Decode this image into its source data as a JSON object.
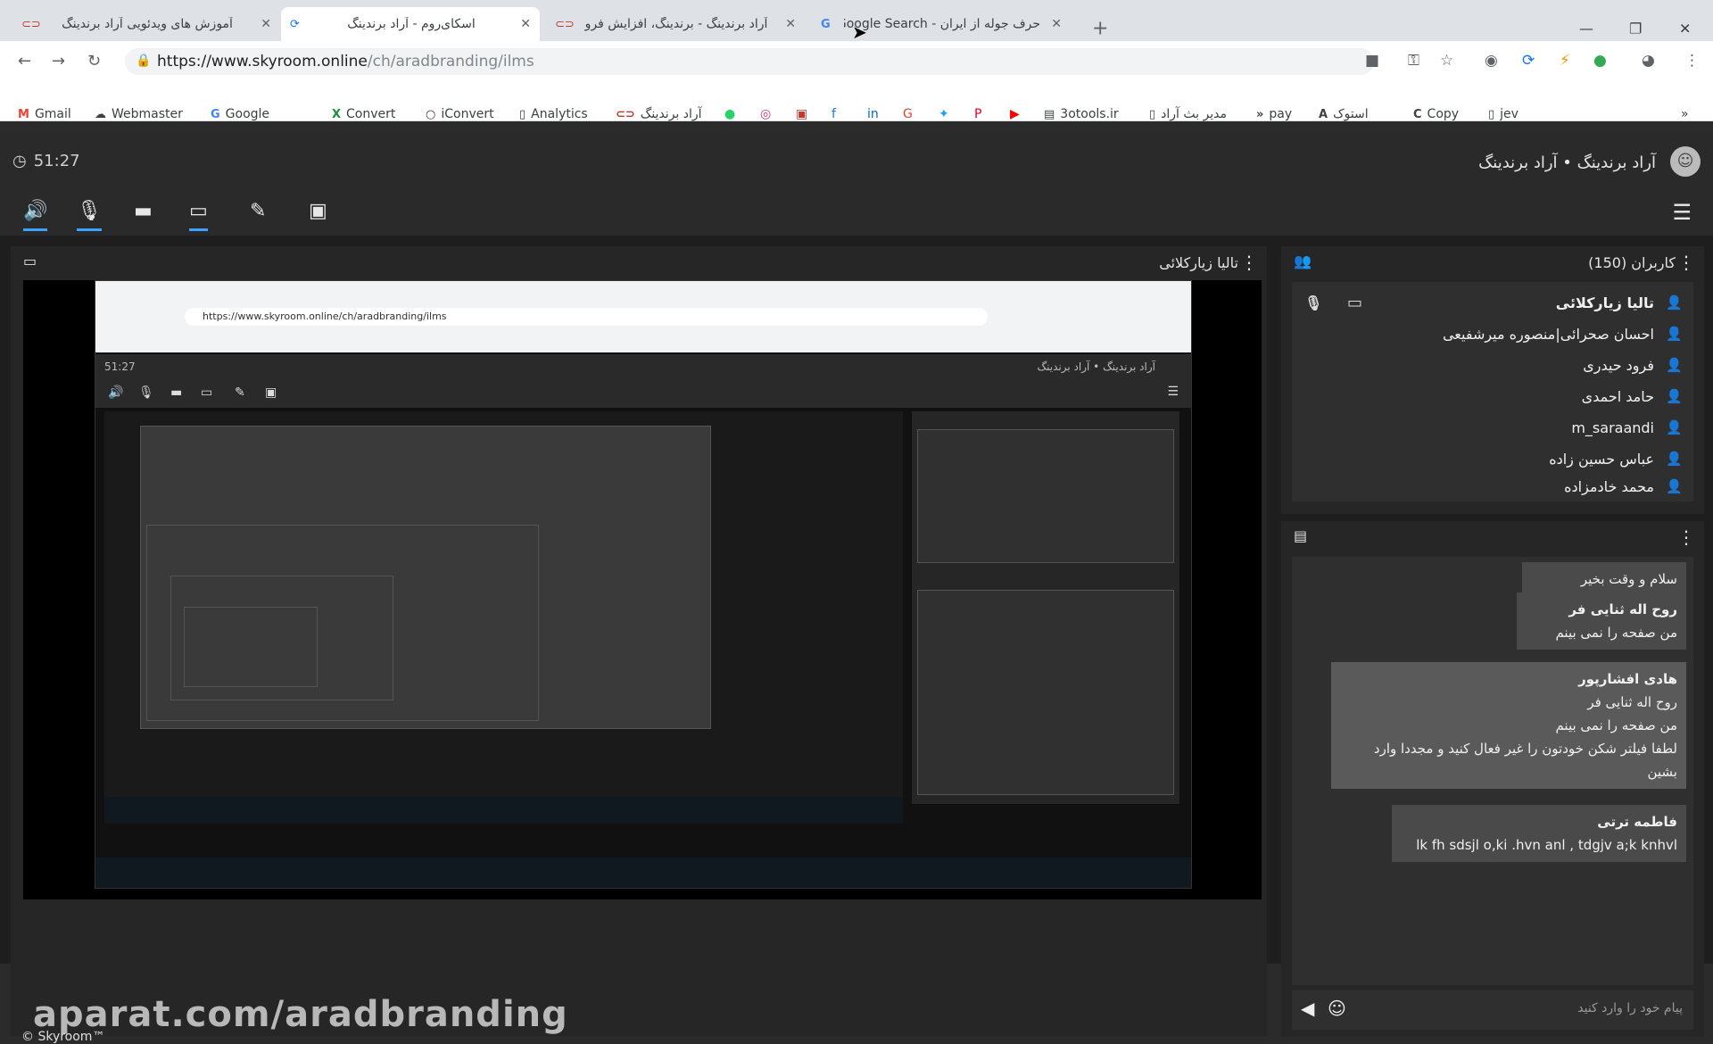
{
  "browser": {
    "tabs": [
      {
        "title": "آموزش های ویدئویی آراد برندینگ",
        "icon": "link-icon"
      },
      {
        "title": "اسکای‌روم - آراد برندینگ",
        "icon": "skyroom-icon",
        "active": true
      },
      {
        "title": "آراد برندینگ - برندینگ، افزایش فرو",
        "icon": "link-icon"
      },
      {
        "title": "حرف جوله از ایران - Google Search",
        "icon": "google-icon"
      }
    ],
    "new_tab": "+",
    "url_main": "https://www.skyroom.online",
    "url_rest": "/ch/aradbranding/ilms",
    "bookmarks": [
      "Gmail",
      "Webmaster",
      "Google",
      "Convert",
      "iConvert",
      "Analytics",
      "آراد برندینگ",
      "3otools.ir",
      "مدیر بث آراد",
      "pay",
      "استوک",
      "Copy",
      "jev"
    ]
  },
  "app": {
    "timer": "51:27",
    "title": "آراد برندینگ • آراد برندینگ",
    "stage_title": "تالیا زیارکلائی",
    "users_title": "کاربران (150)",
    "users": [
      {
        "name": "تالیا زیارکلائی",
        "me": true
      },
      {
        "name": "احسان صحرائی|منصوره میرشفیعی"
      },
      {
        "name": "فرود حیدری"
      },
      {
        "name": "حامد احمدی"
      },
      {
        "name": "m_saraandi"
      },
      {
        "name": "عباس حسین زاده"
      },
      {
        "name": "محمد خادمزاده"
      }
    ],
    "messages": [
      {
        "text": "سلام و وقت بخیر"
      },
      {
        "who": "روح اله ثنایی فر",
        "text": "من صفحه را نمی بینم"
      },
      {
        "who": "هادی افشارپور",
        "text": "روح اله ثنایی فر\nمن صفحه را نمی بینم\nلطفا فیلتر شکن خودتون را غیر فعال کنید و مجددا وارد بشین",
        "self": true
      },
      {
        "who": "فاطمه ترتی",
        "text": "lk fh sdsjl o,ki .hvn anl , tdgjv a;k knhvl"
      }
    ],
    "chat_placeholder": "پیام خود را وارد کنید",
    "watermark": "aparat.com/aradbranding",
    "copyright": "© Skyroom™"
  },
  "inner": {
    "url": "https://www.skyroom.online/ch/aradbranding/ilms",
    "clock": "51:27",
    "title": "آراد برندینگ • آراد برندینگ"
  }
}
